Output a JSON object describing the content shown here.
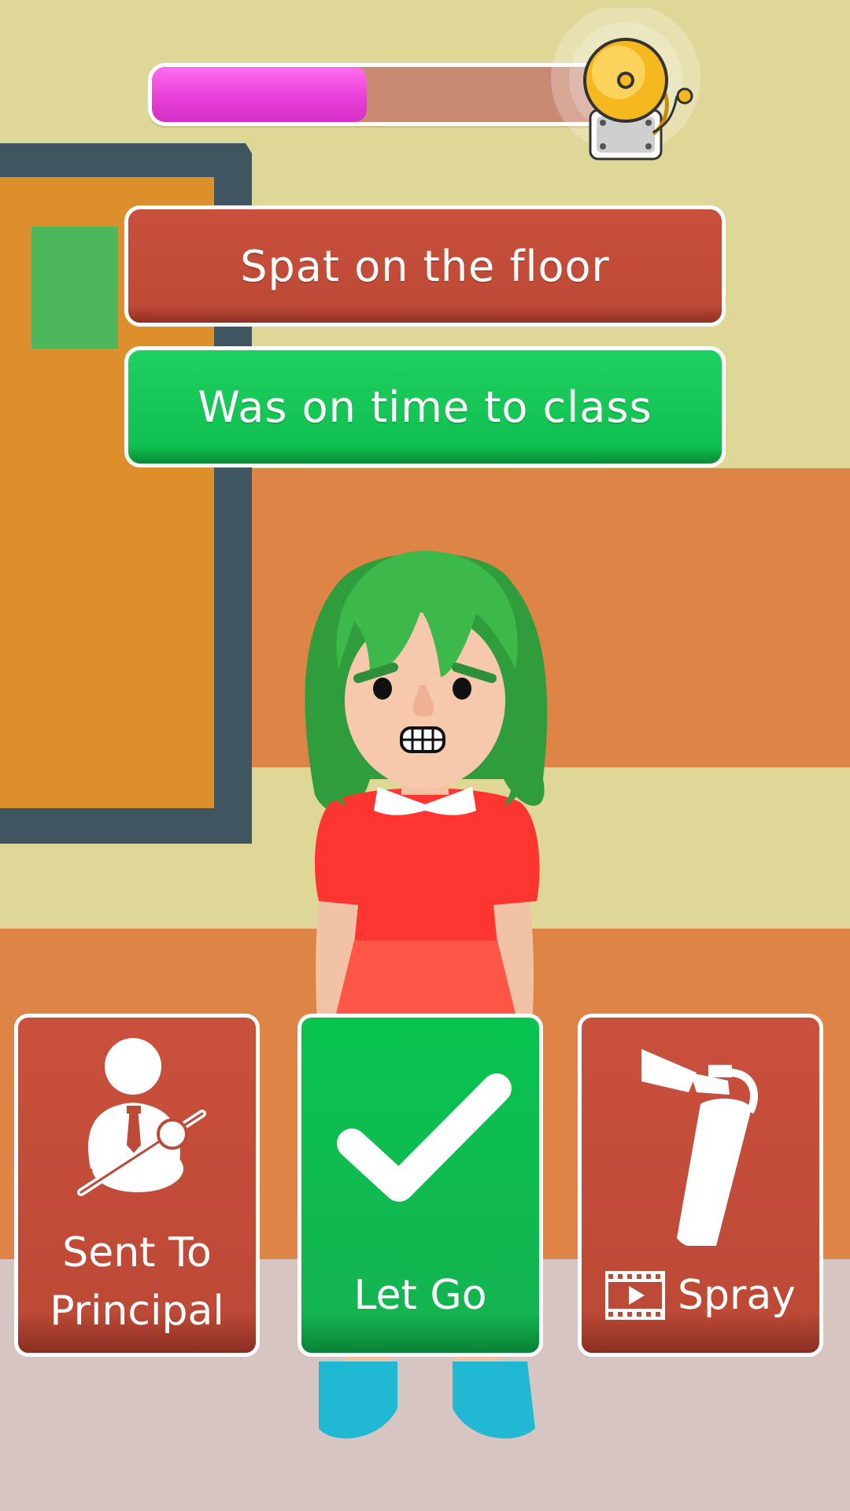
{
  "progress": {
    "fill_fraction": 0.47,
    "color": "#ea3fd8",
    "track_color": "#c98a72"
  },
  "bell": {
    "icon": "school-bell-icon"
  },
  "choices": [
    {
      "label": "Spat on the floor",
      "color": "#bd4a36"
    },
    {
      "label": "Was on time to class",
      "color": "#10bf4f"
    }
  ],
  "actions": {
    "principal": {
      "line1": "Sent To",
      "line2": "Principal",
      "icon": "principal-icon"
    },
    "let_go": {
      "label": "Let Go",
      "icon": "checkmark-icon"
    },
    "spray": {
      "label": "Spray",
      "icon": "fire-extinguisher-icon",
      "badge_icon": "video-ad-icon"
    }
  },
  "character": {
    "hair_color": "#3db84a",
    "dress_color": "#ff3b30",
    "shoe_color": "#21b8d4"
  }
}
